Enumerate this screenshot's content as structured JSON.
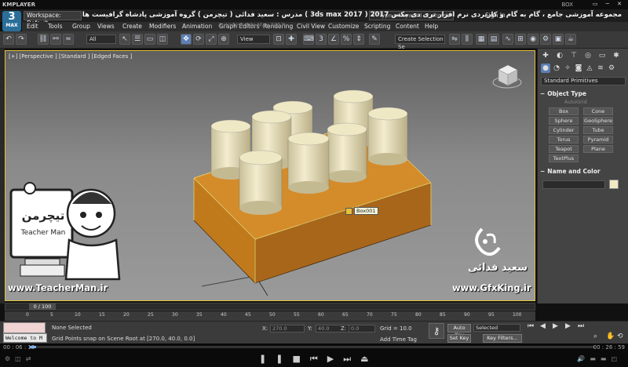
{
  "kmplayer": {
    "brand": "KMPLAYER",
    "window_title": "BOX",
    "window_controls": "▭ ─ ✕",
    "time_current": "00 : 06 : 12",
    "time_total": "00 : 26 : 59",
    "progress_fraction": 0.011
  },
  "max": {
    "logo_text": "3",
    "logo_sub": "MAX",
    "workspace_label": "Workspace: Default",
    "subtitle": "Autodesk 3ds Max 2017",
    "search_placeholder": "Type a keyword or phrase",
    "sign_in": "Sign In",
    "persian_title": "مجموعه آموزشی جامع ، گام به گام و کاربردی نرم افزار تری دی مکس 2017 ( 3ds max 2017 ) مدرس : سعید فدائی ( تیچرمن ) گروه آموزشی پادشاه گرافیست ها"
  },
  "menu": [
    "Edit",
    "Tools",
    "Group",
    "Views",
    "Create",
    "Modifiers",
    "Animation",
    "Graph Editors",
    "Rendering",
    "Civil View",
    "Customize",
    "Scripting",
    "Content",
    "Help"
  ],
  "toolbar": {
    "filter_dd": "All",
    "view_dd": "View",
    "create_selection_dd": "Create Selection Se"
  },
  "viewport": {
    "label": "[+] [Perspective ] [Standard ] [Edged Faces ]",
    "object_label": "Box001"
  },
  "command_panel": {
    "primitives_dd": "Standard Primitives",
    "object_type_title": "Object Type",
    "autogrid": "AutoGrid",
    "buttons": [
      "Box",
      "Cone",
      "Sphere",
      "GeoSphere",
      "Cylinder",
      "Tube",
      "Torus",
      "Pyramid",
      "Teapot",
      "Plane",
      "TextPlus"
    ],
    "name_color_title": "Name and Color"
  },
  "timeline": {
    "slider_text": "0 / 100",
    "ticks": [
      "0",
      "5",
      "10",
      "15",
      "20",
      "25",
      "30",
      "35",
      "40",
      "45",
      "50",
      "55",
      "60",
      "65",
      "70",
      "75",
      "80",
      "85",
      "90",
      "95",
      "100"
    ]
  },
  "status": {
    "welcome": "Welcome to M",
    "selection": "None Selected",
    "prompt": "Grid Points snap on Scene Root at [270.0, 40.0, 0.0]",
    "x_label": "X:",
    "x_value": "270.0",
    "y_label": "Y:",
    "y_value": "40.0",
    "z_label": "Z:",
    "z_value": "0.0",
    "grid": "Grid = 10.0",
    "add_time_tag": "Add Time Tag",
    "auto_key": "Auto Key",
    "set_key": "Set Key",
    "selected_dd": "Selected",
    "key_filters": "Key Filters..."
  },
  "overlays": {
    "teacher_brand": "تیچرمن",
    "teacher_sub": "Teacher Man",
    "teacher_url": "www.TeacherMan.ir",
    "gfx_name": "سعید فدائی",
    "gfx_url": "www.GfxKing.ir"
  },
  "colors": {
    "box_orange": "#c07a1c",
    "cylinder_cream": "#efe8c4",
    "selection_yellow": "#e0c23a",
    "max_blue": "#2a6f9a"
  }
}
